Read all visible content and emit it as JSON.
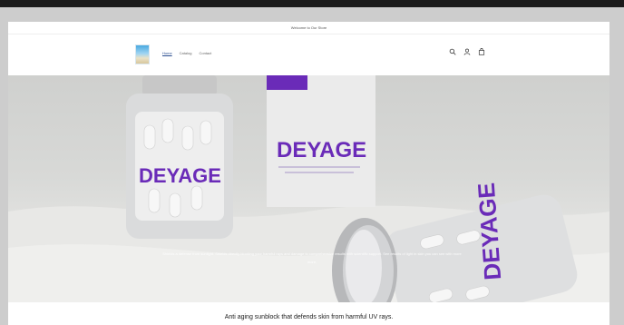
{
  "announcement": "Welcome to Our Store",
  "nav": {
    "items": [
      "Home",
      "Catalog",
      "Contact"
    ]
  },
  "icons": [
    "search-icon",
    "account-icon",
    "cart-icon"
  ],
  "hero": {
    "product_brand": "DEYAGE",
    "caption": "Shields a defense from sunlight. Shields directly blocking your harmful rays and damage to comprehensive results with scientific support. See results of light in skin you can see with more more."
  },
  "tagline": "Anti aging sunblock that defends skin from harmful UV rays.",
  "colors": {
    "brand_purple": "#6a2bb8",
    "accent_link": "#2a4d8f"
  }
}
